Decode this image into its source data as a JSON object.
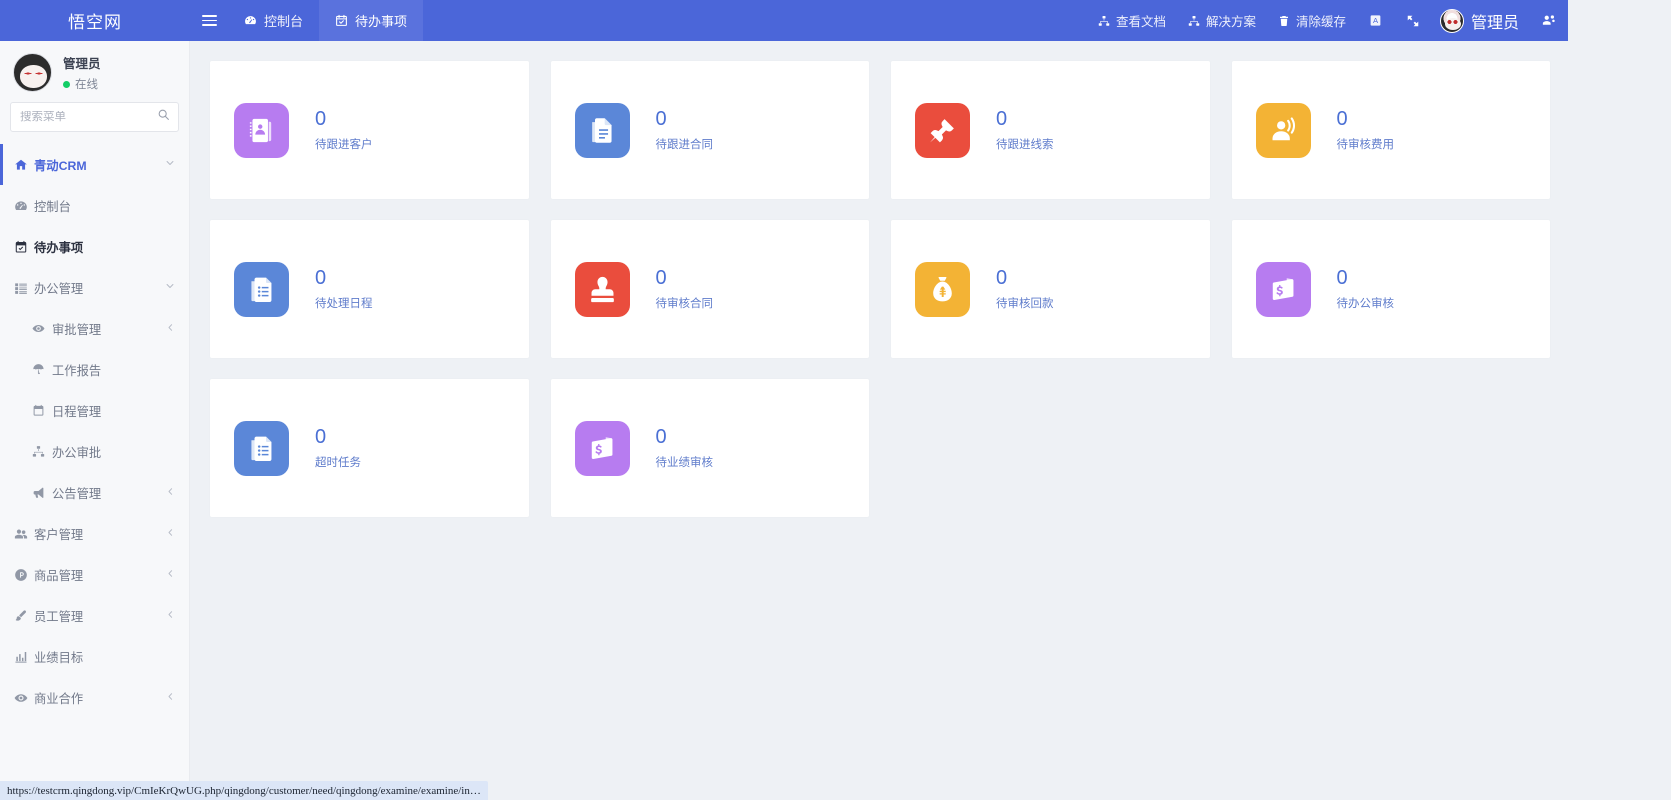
{
  "header": {
    "brand": "悟空网",
    "menu_toggle": "菜单",
    "tabs": [
      {
        "label": "控制台",
        "icon": "dashboard-icon",
        "active": false
      },
      {
        "label": "待办事项",
        "icon": "calendar-check-icon",
        "active": true
      }
    ],
    "right_items": [
      {
        "label": "查看文档",
        "icon": "sitemap-icon"
      },
      {
        "label": "解决方案",
        "icon": "sitemap-icon"
      },
      {
        "label": "清除缓存",
        "icon": "trash-icon"
      }
    ],
    "right_icons": [
      {
        "name": "language-icon",
        "glyph": "A"
      },
      {
        "name": "fullscreen-icon",
        "glyph": "⤡"
      },
      {
        "name": "share-nodes-icon",
        "glyph": "⚙"
      }
    ],
    "user_label": "管理员",
    "accent_color": "#4b66d9",
    "tab_active_color": "#5a72dd"
  },
  "sidebar": {
    "user": {
      "name": "管理员",
      "status": "在线",
      "status_color": "#13ce66"
    },
    "search": {
      "placeholder": "搜索菜单",
      "value": "",
      "icon": "search-icon"
    },
    "items": [
      {
        "label": "青动CRM",
        "icon": "home-icon",
        "level": 1,
        "state": "home",
        "arrow": "chevron-down"
      },
      {
        "label": "控制台",
        "icon": "dashboard-icon",
        "level": 1,
        "state": "normal",
        "arrow": ""
      },
      {
        "label": "待办事项",
        "icon": "calendar-check-icon",
        "level": 1,
        "state": "current",
        "arrow": ""
      },
      {
        "label": "办公管理",
        "icon": "th-list-icon",
        "level": 1,
        "state": "normal",
        "arrow": "chevron-down"
      },
      {
        "label": "审批管理",
        "icon": "eye-icon",
        "level": 2,
        "state": "normal",
        "arrow": "chevron-left"
      },
      {
        "label": "工作报告",
        "icon": "umbrella-icon",
        "level": 2,
        "state": "normal",
        "arrow": ""
      },
      {
        "label": "日程管理",
        "icon": "calendar-icon",
        "level": 2,
        "state": "normal",
        "arrow": ""
      },
      {
        "label": "办公审批",
        "icon": "sitemap-icon",
        "level": 2,
        "state": "normal",
        "arrow": ""
      },
      {
        "label": "公告管理",
        "icon": "bullhorn-icon",
        "level": 2,
        "state": "normal",
        "arrow": "chevron-left"
      },
      {
        "label": "客户管理",
        "icon": "users-icon",
        "level": 1,
        "state": "normal",
        "arrow": "chevron-left"
      },
      {
        "label": "商品管理",
        "icon": "circle-p-icon",
        "level": 1,
        "state": "normal",
        "arrow": "chevron-left"
      },
      {
        "label": "员工管理",
        "icon": "brush-icon",
        "level": 1,
        "state": "normal",
        "arrow": "chevron-left"
      },
      {
        "label": "业绩目标",
        "icon": "bar-chart-icon",
        "level": 1,
        "state": "normal",
        "arrow": ""
      },
      {
        "label": "商业合作",
        "icon": "handshake-icon",
        "level": 1,
        "state": "normal",
        "arrow": "chevron-left"
      }
    ]
  },
  "main": {
    "cards": [
      {
        "count": "0",
        "label": "待跟进客户",
        "icon": "contact-card-icon",
        "color": "#b77cf0"
      },
      {
        "count": "0",
        "label": "待跟进合同",
        "icon": "file-text-icon",
        "color": "#5b87d8"
      },
      {
        "count": "0",
        "label": "待跟进线索",
        "icon": "thumbtack-icon",
        "color": "#ea4d3d"
      },
      {
        "count": "0",
        "label": "待审核费用",
        "icon": "user-megaphone-icon",
        "color": "#f3b335"
      },
      {
        "count": "0",
        "label": "待处理日程",
        "icon": "checklist-icon",
        "color": "#5b87d8"
      },
      {
        "count": "0",
        "label": "待审核合同",
        "icon": "stamp-icon",
        "color": "#ea4d3d"
      },
      {
        "count": "0",
        "label": "待审核回款",
        "icon": "money-bag-icon",
        "color": "#f3b335"
      },
      {
        "count": "0",
        "label": "待办公审核",
        "icon": "receipt-icon",
        "color": "#b77cf0"
      },
      {
        "count": "0",
        "label": "超时任务",
        "icon": "checklist-icon",
        "color": "#5b87d8"
      },
      {
        "count": "0",
        "label": "待业绩审核",
        "icon": "receipt-icon",
        "color": "#b77cf0"
      }
    ],
    "number_color": "#4a6fd4",
    "label_color": "#5f7ccb"
  },
  "statusbar": {
    "url": "https://testcrm.qingdong.vip/CmIeKrQwUG.php/qingdong/customer/need/qingdong/examine/examine/in…"
  }
}
